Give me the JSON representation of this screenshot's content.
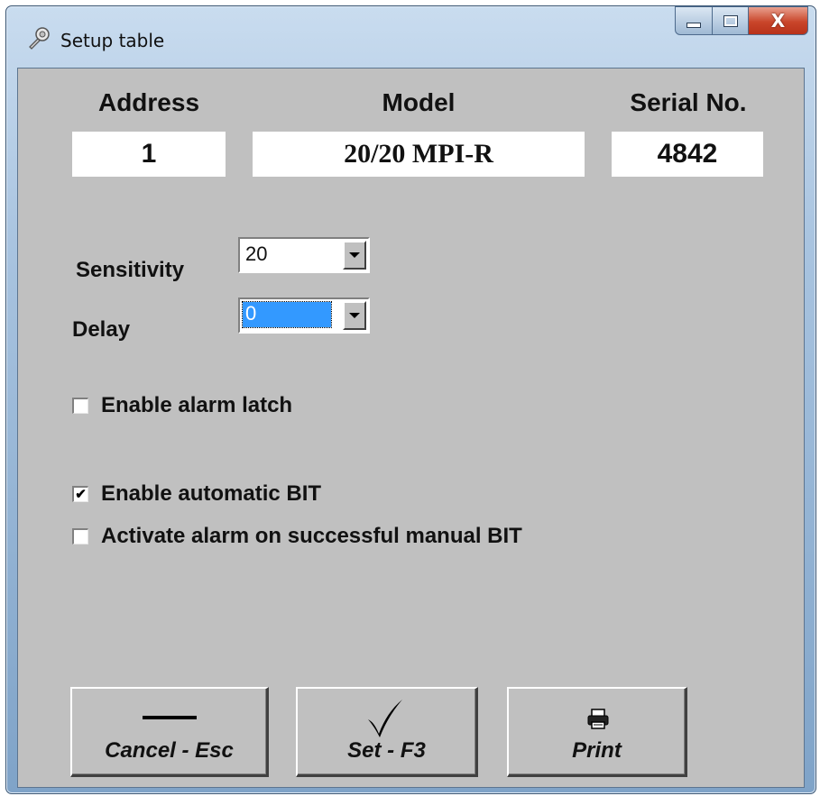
{
  "window": {
    "title": "Setup table"
  },
  "caption": {
    "close_glyph": "X"
  },
  "device": {
    "address_label": "Address",
    "model_label": "Model",
    "serial_label": "Serial No.",
    "address": "1",
    "model": "20/20 MPI-R",
    "serial": "4842"
  },
  "settings": {
    "sensitivity_label": "Sensitivity",
    "sensitivity_value": "20",
    "delay_label": "Delay",
    "delay_value": "0"
  },
  "options": [
    {
      "label": "Enable alarm latch",
      "checked": false
    },
    {
      "label": "Enable automatic BIT",
      "checked": true
    },
    {
      "label": "Activate alarm on successful manual BIT",
      "checked": false
    }
  ],
  "buttons": {
    "cancel": "Cancel - Esc",
    "set": "Set - F3",
    "print": "Print"
  },
  "colors": {
    "client_bg": "#c0c0c0",
    "selection": "#3399ff"
  }
}
